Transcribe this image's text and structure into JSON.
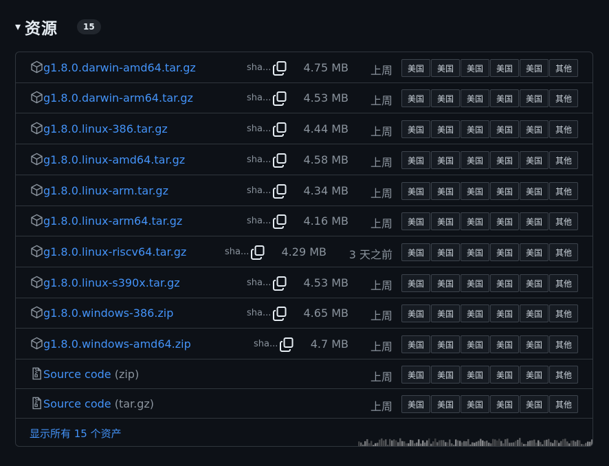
{
  "header": {
    "caret": "▾",
    "title": "资源",
    "count": "15"
  },
  "assets": [
    {
      "name": "g1.8.0.darwin-amd64.tar.gz",
      "sha": "sha...",
      "size": "4.75 MB",
      "date": "上周"
    },
    {
      "name": "g1.8.0.darwin-arm64.tar.gz",
      "sha": "sha...",
      "size": "4.53 MB",
      "date": "上周"
    },
    {
      "name": "g1.8.0.linux-386.tar.gz",
      "sha": "sha...",
      "size": "4.44 MB",
      "date": "上周"
    },
    {
      "name": "g1.8.0.linux-amd64.tar.gz",
      "sha": "sha...",
      "size": "4.58 MB",
      "date": "上周"
    },
    {
      "name": "g1.8.0.linux-arm.tar.gz",
      "sha": "sha...",
      "size": "4.34 MB",
      "date": "上周"
    },
    {
      "name": "g1.8.0.linux-arm64.tar.gz",
      "sha": "sha...",
      "size": "4.16 MB",
      "date": "上周"
    },
    {
      "name": "g1.8.0.linux-riscv64.tar.gz",
      "sha": "sha...",
      "size": "4.29 MB",
      "date": "3 天之前"
    },
    {
      "name": "g1.8.0.linux-s390x.tar.gz",
      "sha": "sha...",
      "size": "4.53 MB",
      "date": "上周"
    },
    {
      "name": "g1.8.0.windows-386.zip",
      "sha": "sha...",
      "size": "4.65 MB",
      "date": "上周"
    },
    {
      "name": "g1.8.0.windows-amd64.zip",
      "sha": "sha...",
      "size": "4.7 MB",
      "date": "上周"
    }
  ],
  "sources": [
    {
      "label": "Source code",
      "suffix": "(zip)",
      "date": "上周"
    },
    {
      "label": "Source code",
      "suffix": "(tar.gz)",
      "date": "上周"
    }
  ],
  "badges": [
    "美国",
    "美国",
    "美国",
    "美国",
    "美国",
    "其他"
  ],
  "footer": {
    "show_all": "显示所有 15 个资产"
  },
  "icons": {
    "asset": "package-icon",
    "source": "file-zip-icon",
    "copy": "copy-icon"
  },
  "colors": {
    "link": "#4493f8",
    "muted": "#8b949e",
    "border": "#30363d",
    "bg": "#0d1117"
  }
}
